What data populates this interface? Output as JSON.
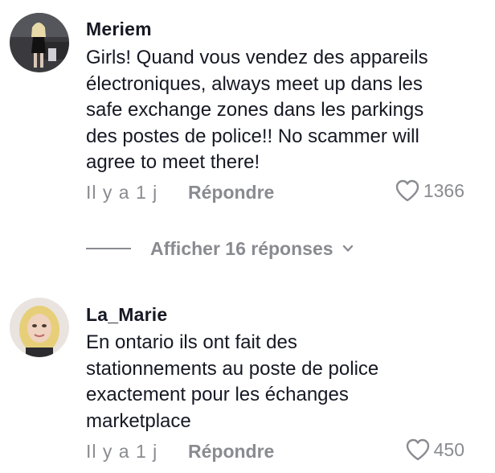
{
  "comments": [
    {
      "username": "Meriem",
      "text": "Girls! Quand vous vendez des appareils\nélectroniques, always meet up dans les\nsafe exchange zones dans les parkings\ndes postes de police!! No scammer will\nagree to meet there!",
      "time": "Il y a 1 j",
      "reply_label": "Répondre",
      "likes": "1366",
      "avatar_icon": "profile-photo"
    },
    {
      "username": "La_Marie",
      "text": "En ontario ils ont fait des\nstationnements au poste de police\nexactement pour les échanges\nmarketplace",
      "time": "Il y a 1 j",
      "reply_label": "Répondre",
      "likes": "450",
      "avatar_icon": "profile-photo"
    }
  ],
  "view_replies": {
    "label": "Afficher 16 réponses",
    "icon": "chevron-down-icon"
  },
  "colors": {
    "text": "#161823",
    "muted": "#8a8b91"
  }
}
